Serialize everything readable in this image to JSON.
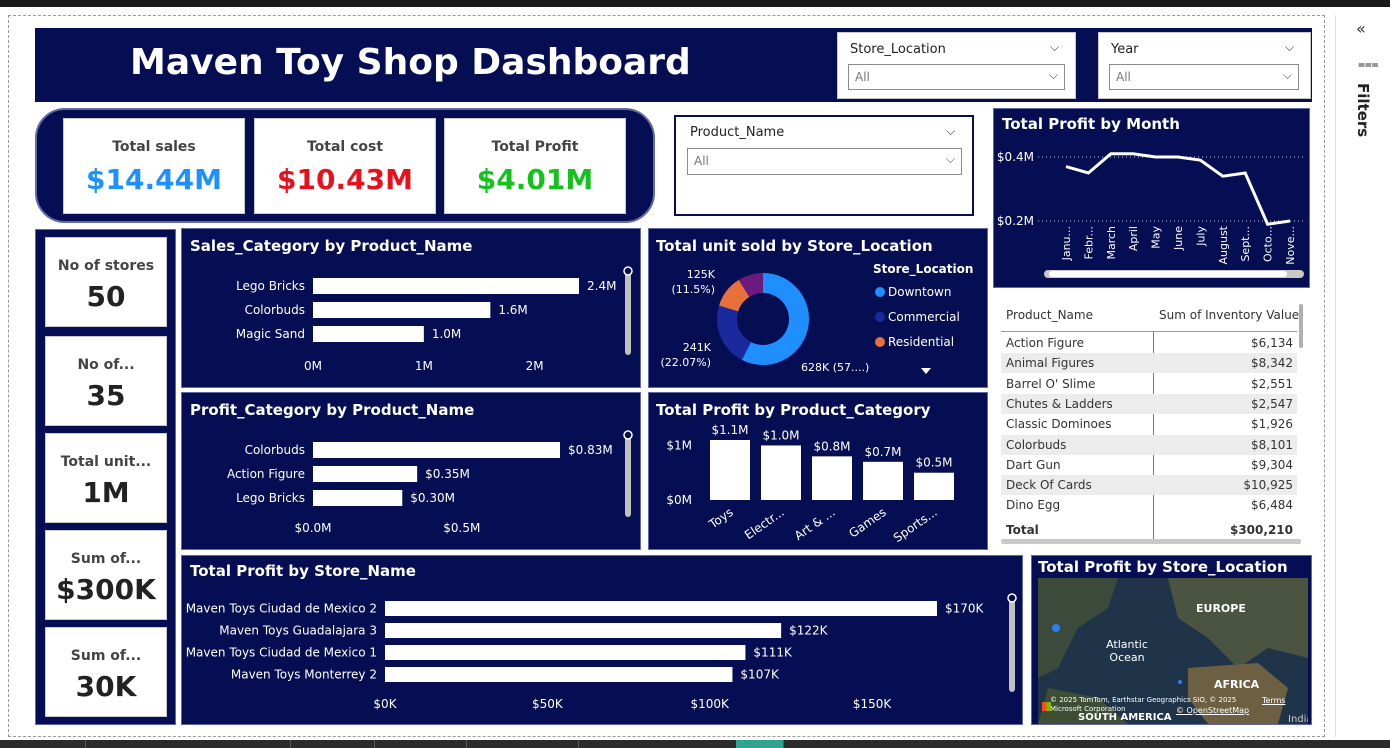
{
  "dashboard_title": "Maven Toy Shop Dashboard",
  "slicers": {
    "store_location": {
      "label": "Store_Location",
      "value": "All"
    },
    "year": {
      "label": "Year",
      "value": "All"
    },
    "product_name": {
      "label": "Product_Name",
      "value": "All"
    }
  },
  "kpis": {
    "total_sales": {
      "label": "Total sales",
      "value": "$14.44M",
      "color": "#1e90ff"
    },
    "total_cost": {
      "label": "Total cost",
      "value": "$10.43M",
      "color": "#e8101a"
    },
    "total_profit": {
      "label": "Total Profit",
      "value": "$4.01M",
      "color": "#14c21e"
    }
  },
  "side_kpis": [
    {
      "label": "No of stores",
      "value": "50"
    },
    {
      "label": "No of...",
      "value": "35"
    },
    {
      "label": "Total unit...",
      "value": "1M"
    },
    {
      "label": "Sum of...",
      "value": "$300K"
    },
    {
      "label": "Sum of...",
      "value": "30K"
    }
  ],
  "filters_pane": {
    "label": "Filters",
    "collapse_glyph": "«",
    "filter_glyph": "⩶"
  },
  "chart_data": [
    {
      "id": "sales_category",
      "type": "bar",
      "orientation": "horizontal",
      "title": "Sales_Category by Product_Name",
      "categories": [
        "Lego Bricks",
        "Colorbuds",
        "Magic Sand"
      ],
      "values": [
        2.4,
        1.6,
        1.0
      ],
      "data_labels": [
        "2.4M",
        "1.6M",
        "1.0M"
      ],
      "xlim": [
        0,
        2.4
      ],
      "xticks": [
        0,
        1,
        2
      ],
      "xtick_labels": [
        "0M",
        "1M",
        "2M"
      ]
    },
    {
      "id": "profit_category",
      "type": "bar",
      "orientation": "horizontal",
      "title": "Profit_Category by Product_Name",
      "categories": [
        "Colorbuds",
        "Action Figure",
        "Lego Bricks"
      ],
      "values": [
        0.83,
        0.35,
        0.3
      ],
      "data_labels": [
        "$0.83M",
        "$0.35M",
        "$0.30M"
      ],
      "xlim": [
        0,
        0.83
      ],
      "xticks": [
        0,
        0.5
      ],
      "xtick_labels": [
        "$0.0M",
        "$0.5M"
      ]
    },
    {
      "id": "units_by_location",
      "type": "pie",
      "title": "Total unit sold by Store_Location",
      "legend_title": "Store_Location",
      "legend_position": "right",
      "slices": [
        {
          "name": "Downtown",
          "value": 628,
          "label": "628K (57....)",
          "color": "#1f8fff"
        },
        {
          "name": "Commercial",
          "value": 241,
          "label": "241K\n(22.07%)",
          "color": "#1a2a9c"
        },
        {
          "name": "Residential",
          "value": 125,
          "label": "125K\n(11.5%)",
          "color": "#e8703a"
        },
        {
          "name": "",
          "value": 96,
          "label": "",
          "color": "#6b1a7e"
        }
      ]
    },
    {
      "id": "profit_by_category",
      "type": "bar",
      "title": "Total Profit by Product_Category",
      "categories": [
        "Toys",
        "Electr...",
        "Art & ...",
        "Games",
        "Sports..."
      ],
      "values": [
        1.1,
        1.0,
        0.8,
        0.7,
        0.5
      ],
      "data_labels": [
        "$1.1M",
        "$1.0M",
        "$0.8M",
        "$0.7M",
        "$0.5M"
      ],
      "ylim": [
        0,
        1.1
      ],
      "yticks": [
        0,
        1
      ],
      "ytick_labels": [
        "$0M",
        "$1M"
      ]
    },
    {
      "id": "profit_by_store",
      "type": "bar",
      "orientation": "horizontal",
      "title": "Total Profit by Store_Name",
      "categories": [
        "Maven Toys Ciudad de Mexico 2",
        "Maven Toys Guadalajara 3",
        "Maven Toys Ciudad de Mexico 1",
        "Maven Toys Monterrey 2"
      ],
      "values": [
        170,
        122,
        111,
        107
      ],
      "data_labels": [
        "$170K",
        "$122K",
        "$111K",
        "$107K"
      ],
      "xlim": [
        0,
        170
      ],
      "xticks": [
        0,
        50,
        100,
        150
      ],
      "xtick_labels": [
        "$0K",
        "$50K",
        "$100K",
        "$150K"
      ]
    },
    {
      "id": "profit_by_month",
      "type": "line",
      "title": "Total Profit by Month",
      "categories": [
        "Janu...",
        "Febr...",
        "March",
        "April",
        "May",
        "June",
        "July",
        "August",
        "Sept...",
        "Octo...",
        "Nove..."
      ],
      "values": [
        0.37,
        0.35,
        0.41,
        0.41,
        0.4,
        0.4,
        0.39,
        0.34,
        0.35,
        0.19,
        0.2
      ],
      "ylim": [
        0.15,
        0.45
      ],
      "yticks": [
        0.2,
        0.4
      ],
      "ytick_labels": [
        "$0.2M",
        "$0.4M"
      ],
      "grid": true
    }
  ],
  "inventory_table": {
    "headers": [
      "Product_Name",
      "Sum of Inventory Value"
    ],
    "rows": [
      [
        "Action Figure",
        "$6,134"
      ],
      [
        "Animal Figures",
        "$8,342"
      ],
      [
        "Barrel O' Slime",
        "$2,551"
      ],
      [
        "Chutes & Ladders",
        "$2,547"
      ],
      [
        "Classic Dominoes",
        "$1,926"
      ],
      [
        "Colorbuds",
        "$8,101"
      ],
      [
        "Dart Gun",
        "$9,304"
      ],
      [
        "Deck Of Cards",
        "$10,925"
      ],
      [
        "Dino Egg",
        "$6,484"
      ]
    ],
    "total": [
      "Total",
      "$300,210"
    ]
  },
  "map": {
    "title": "Total Profit by Store_Location",
    "labels": {
      "europe": "EUROPE",
      "ocean": "Atlantic\nOcean",
      "africa": "AFRICA",
      "south_america": "SOUTH AMERICA",
      "india": "India"
    },
    "attribution": "© 2025 TomTom, Earthstar Geographics SIO, © 2025 Microsoft Corporation",
    "terms": "Terms",
    "osm": "© OpenStreetMap"
  }
}
